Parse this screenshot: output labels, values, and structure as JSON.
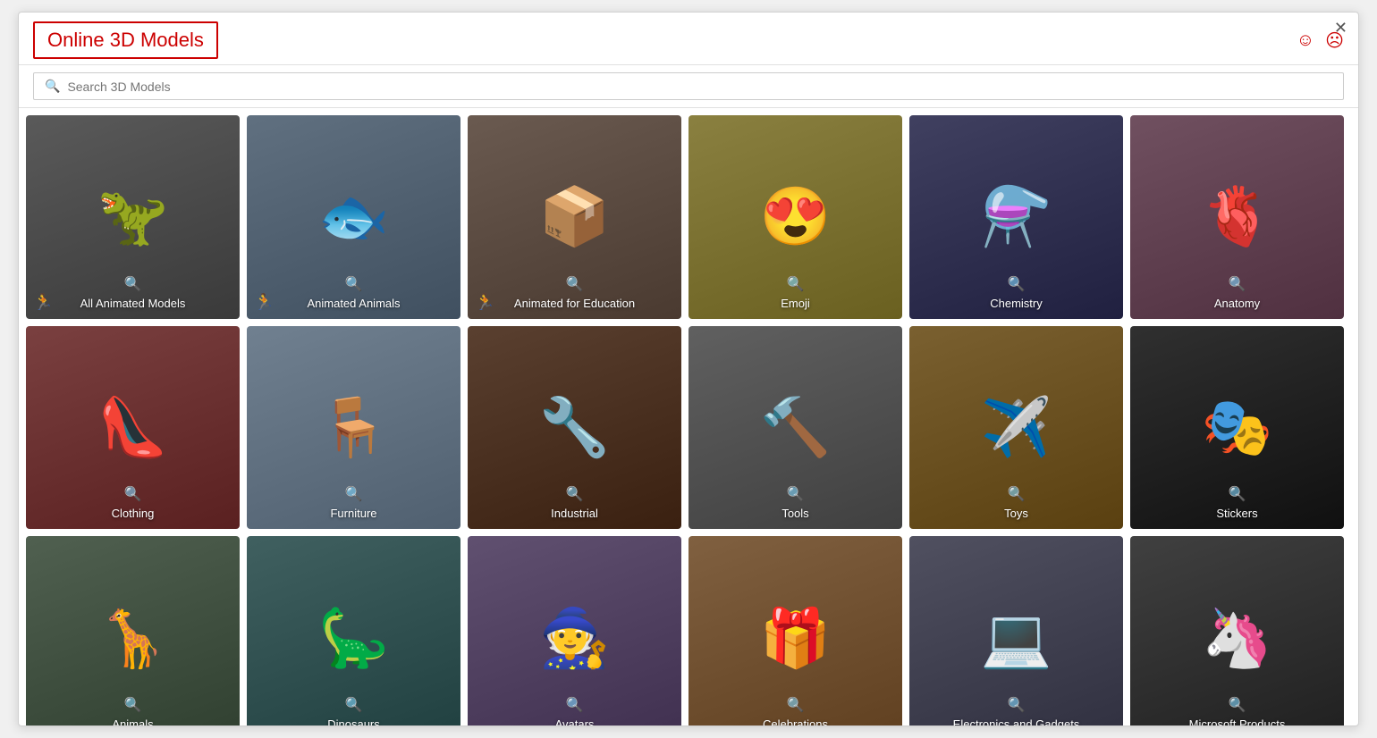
{
  "window": {
    "title": "Online 3D Models",
    "close_label": "✕",
    "face_happy": "☺",
    "face_sad": "☹"
  },
  "search": {
    "placeholder": "Search 3D Models"
  },
  "cards": [
    {
      "id": "all-animated",
      "label": "All Animated Models",
      "emoji": "🦖",
      "has_anim": true,
      "tint": "tint-dark"
    },
    {
      "id": "animated-animals",
      "label": "Animated Animals",
      "emoji": "🐟",
      "has_anim": true,
      "tint": "tint-blue"
    },
    {
      "id": "animated-education",
      "label": "Animated for Education",
      "emoji": "📦",
      "has_anim": true,
      "tint": "tint-warm"
    },
    {
      "id": "emoji",
      "label": "Emoji",
      "emoji": "😍",
      "has_anim": false,
      "tint": "tint-yellow"
    },
    {
      "id": "chemistry",
      "label": "Chemistry",
      "emoji": "⚗️",
      "has_anim": false,
      "tint": "tint-navy"
    },
    {
      "id": "anatomy",
      "label": "Anatomy",
      "emoji": "🫀",
      "has_anim": false,
      "tint": "tint-pink"
    },
    {
      "id": "clothing",
      "label": "Clothing",
      "emoji": "👠",
      "has_anim": false,
      "tint": "tint-red-card"
    },
    {
      "id": "furniture",
      "label": "Furniture",
      "emoji": "🪑",
      "has_anim": false,
      "tint": "tint-beach"
    },
    {
      "id": "industrial",
      "label": "Industrial",
      "emoji": "🔧",
      "has_anim": false,
      "tint": "tint-brown"
    },
    {
      "id": "tools",
      "label": "Tools",
      "emoji": "🔨",
      "has_anim": false,
      "tint": "tint-gray"
    },
    {
      "id": "toys",
      "label": "Toys",
      "emoji": "✈️",
      "has_anim": false,
      "tint": "tint-orange"
    },
    {
      "id": "stickers",
      "label": "Stickers",
      "emoji": "🎭",
      "has_anim": false,
      "tint": "tint-black"
    },
    {
      "id": "animals",
      "label": "Animals",
      "emoji": "🦒",
      "has_anim": false,
      "tint": "tint-green-gray"
    },
    {
      "id": "dinosaurs",
      "label": "Dinosaurs",
      "emoji": "🦕",
      "has_anim": false,
      "tint": "tint-teal"
    },
    {
      "id": "avatars",
      "label": "Avatars",
      "emoji": "🧙",
      "has_anim": false,
      "tint": "tint-purple"
    },
    {
      "id": "celebrations",
      "label": "Celebrations",
      "emoji": "🎁",
      "has_anim": false,
      "tint": "tint-gold"
    },
    {
      "id": "electronics",
      "label": "Electronics and Gadgets",
      "emoji": "💻",
      "has_anim": false,
      "tint": "tint-slate"
    },
    {
      "id": "microsoft",
      "label": "Microsoft Products",
      "emoji": "🦄",
      "has_anim": false,
      "tint": "tint-charcoal"
    }
  ],
  "search_icon": "🔍",
  "anim_icon": "🏃"
}
